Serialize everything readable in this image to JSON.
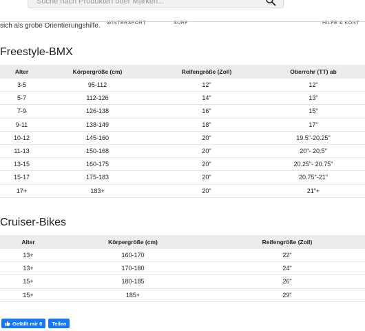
{
  "header": {
    "search": {
      "placeholder": "Suche nach Produkten oder Marken..."
    },
    "nav": {
      "item_winter": "WINTERSPORT",
      "item_surf": "SURF",
      "item_help": "HILFE & KONT"
    }
  },
  "intro_text": "sich als grobe Orientierungshilfe.",
  "sections": [
    {
      "title": "Freestyle-BMX",
      "columns": [
        "Alter",
        "Körpergröße (cm)",
        "Reifengröße (Zoll)",
        "Oberrohr (TT) ab"
      ],
      "rows": [
        [
          "3-5",
          "95-112",
          "12\"",
          "12\""
        ],
        [
          "5-7",
          "112-126",
          "14\"",
          "13\""
        ],
        [
          "7-9",
          "126-138",
          "16\"",
          "15\""
        ],
        [
          "9-11",
          "138-149",
          "18\"",
          "17\""
        ],
        [
          "10-12",
          "145-160",
          "20\"",
          "19.5\"-20.25\""
        ],
        [
          "11-13",
          "150-168",
          "20\"",
          "20\"- 20.5\""
        ],
        [
          "13-15",
          "160-175",
          "20\"",
          "20.25\"- 20.75\""
        ],
        [
          "15-17",
          "175-183",
          "20\"",
          "20.75\"-21\""
        ],
        [
          "17+",
          "183+",
          "20\"",
          "21\"+"
        ]
      ]
    },
    {
      "title": "Cruiser-Bikes",
      "columns": [
        "Alter",
        "Körpergröße (cm)",
        "Reifengröße (Zoll)"
      ],
      "rows": [
        [
          "13+",
          "160-170",
          "22\""
        ],
        [
          "13+",
          "170-180",
          "24\""
        ],
        [
          "15+",
          "180-185",
          "26\""
        ],
        [
          "15+",
          "185+",
          "29\""
        ]
      ]
    }
  ],
  "social": {
    "like_label": "Gefällt mir 6",
    "share_label": "Teilen",
    "like_icon": "thumbs-up-icon",
    "brand_color": "#1877f2"
  }
}
